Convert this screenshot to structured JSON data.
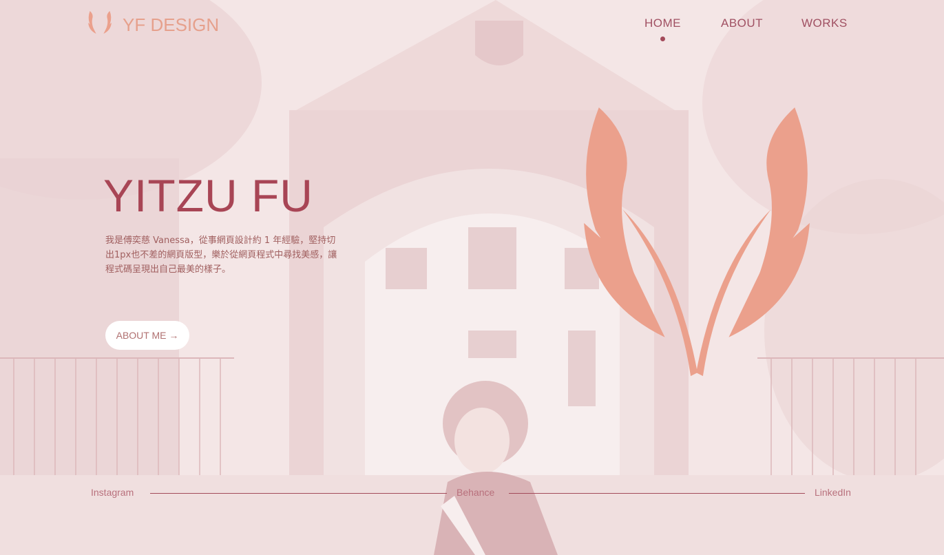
{
  "brand": {
    "name": "YF DESIGN",
    "logo_icon": "fox-ears-logo-icon"
  },
  "nav": {
    "items": [
      {
        "label": "HOME",
        "active": true
      },
      {
        "label": "ABOUT",
        "active": false
      },
      {
        "label": "WORKS",
        "active": false
      }
    ]
  },
  "hero": {
    "title": "YITZU FU",
    "description": "我是傅奕慈 Vanessa，從事網頁設計約 1 年經驗，堅持切出1px也不差的網頁版型，樂於從網頁程式中尋找美感，讓程式碼呈現出自己最美的樣子。",
    "cta_label": "ABOUT ME →"
  },
  "social": {
    "links": [
      "Instagram",
      "Behance",
      "LinkedIn"
    ]
  },
  "colors": {
    "accent": "#eba08c",
    "primary": "#a84555",
    "background": "#f3e4e4"
  }
}
